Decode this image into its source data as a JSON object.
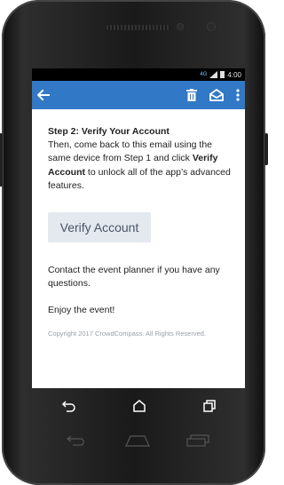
{
  "status_bar": {
    "signal_badge": "4G",
    "time": "4:00"
  },
  "app_bar": {
    "back_icon": "arrow-left-icon",
    "delete_icon": "trash-icon",
    "mark_unread_icon": "open-envelope-icon",
    "overflow_icon": "more-vertical-icon"
  },
  "email": {
    "step_title": "Step 2: Verify Your Account",
    "body_part1": "Then, come back to this email using the same device from Step 1 and click ",
    "body_bold": "Verify Account",
    "body_part2": " to unlock all of the app’s advanced features.",
    "verify_button": "Verify Account",
    "contact_text": "Contact the event planner if you have any questions.",
    "enjoy_text": "Enjoy the event!",
    "copyright": "Copyright 2017 CrowdCompass. All Rights Reserved."
  },
  "nav_bar": {
    "back": "back-icon",
    "home": "home-icon",
    "recents": "recents-icon"
  },
  "colors": {
    "app_bar": "#3178c6",
    "button_bg": "#e4e9ef"
  }
}
